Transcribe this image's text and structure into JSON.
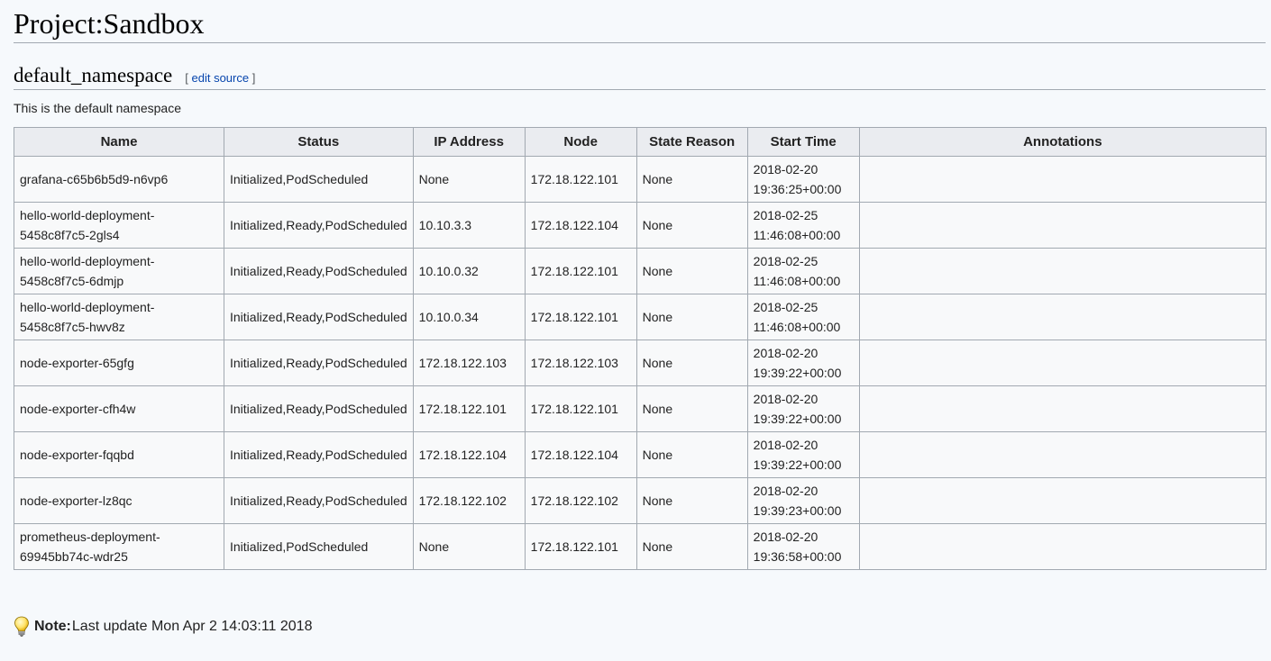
{
  "page": {
    "title": "Project:Sandbox",
    "section_title": "default_namespace",
    "edit_bracket_open": "[",
    "edit_link": "edit source",
    "edit_bracket_close": "]",
    "description": "This is the default namespace"
  },
  "table": {
    "columns": [
      "Name",
      "Status",
      "IP Address",
      "Node",
      "State Reason",
      "Start Time",
      "Annotations"
    ],
    "rows": [
      {
        "name": [
          "grafana-c65b6b5d9-n6vp6"
        ],
        "status": "Initialized,PodScheduled",
        "ip": "None",
        "node": "172.18.122.101",
        "reason": "None",
        "start": [
          "2018-02-20",
          "19:36:25+00:00"
        ],
        "annotations": ""
      },
      {
        "name": [
          "hello-world-deployment-",
          "5458c8f7c5-2gls4"
        ],
        "status": "Initialized,Ready,PodScheduled",
        "ip": "10.10.3.3",
        "node": "172.18.122.104",
        "reason": "None",
        "start": [
          "2018-02-25",
          "11:46:08+00:00"
        ],
        "annotations": ""
      },
      {
        "name": [
          "hello-world-deployment-",
          "5458c8f7c5-6dmjp"
        ],
        "status": "Initialized,Ready,PodScheduled",
        "ip": "10.10.0.32",
        "node": "172.18.122.101",
        "reason": "None",
        "start": [
          "2018-02-25",
          "11:46:08+00:00"
        ],
        "annotations": ""
      },
      {
        "name": [
          "hello-world-deployment-",
          "5458c8f7c5-hwv8z"
        ],
        "status": "Initialized,Ready,PodScheduled",
        "ip": "10.10.0.34",
        "node": "172.18.122.101",
        "reason": "None",
        "start": [
          "2018-02-25",
          "11:46:08+00:00"
        ],
        "annotations": ""
      },
      {
        "name": [
          "node-exporter-65gfg"
        ],
        "status": "Initialized,Ready,PodScheduled",
        "ip": "172.18.122.103",
        "node": "172.18.122.103",
        "reason": "None",
        "start": [
          "2018-02-20",
          "19:39:22+00:00"
        ],
        "annotations": ""
      },
      {
        "name": [
          "node-exporter-cfh4w"
        ],
        "status": "Initialized,Ready,PodScheduled",
        "ip": "172.18.122.101",
        "node": "172.18.122.101",
        "reason": "None",
        "start": [
          "2018-02-20",
          "19:39:22+00:00"
        ],
        "annotations": ""
      },
      {
        "name": [
          "node-exporter-fqqbd"
        ],
        "status": "Initialized,Ready,PodScheduled",
        "ip": "172.18.122.104",
        "node": "172.18.122.104",
        "reason": "None",
        "start": [
          "2018-02-20",
          "19:39:22+00:00"
        ],
        "annotations": ""
      },
      {
        "name": [
          "node-exporter-lz8qc"
        ],
        "status": "Initialized,Ready,PodScheduled",
        "ip": "172.18.122.102",
        "node": "172.18.122.102",
        "reason": "None",
        "start": [
          "2018-02-20",
          "19:39:23+00:00"
        ],
        "annotations": ""
      },
      {
        "name": [
          "prometheus-deployment-",
          "69945bb74c-wdr25"
        ],
        "status": "Initialized,PodScheduled",
        "ip": "None",
        "node": "172.18.122.101",
        "reason": "None",
        "start": [
          "2018-02-20",
          "19:36:58+00:00"
        ],
        "annotations": ""
      }
    ]
  },
  "note": {
    "icon": "lightbulb-icon",
    "label": "Note:",
    "text": "Last update Mon Apr 2 14:03:11 2018"
  },
  "colors": {
    "background": "#f6f9fc",
    "link": "#0645ad",
    "table_header": "#eaecf0",
    "border": "#a2a9b1"
  }
}
